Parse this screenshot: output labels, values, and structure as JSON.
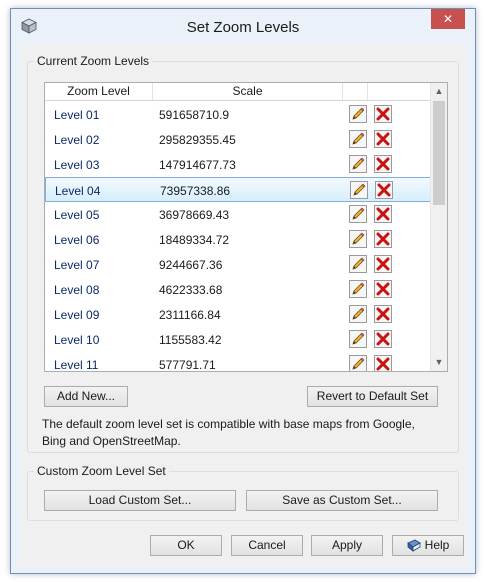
{
  "window": {
    "title": "Set Zoom Levels",
    "close_glyph": "✕"
  },
  "current_group": {
    "label": "Current Zoom Levels"
  },
  "grid": {
    "columns": [
      "Zoom Level",
      "Scale"
    ],
    "rows": [
      {
        "level": "Level 01",
        "scale": "591658710.9"
      },
      {
        "level": "Level 02",
        "scale": "295829355.45"
      },
      {
        "level": "Level 03",
        "scale": "147914677.73"
      },
      {
        "level": "Level 04",
        "scale": "73957338.86",
        "selected": true
      },
      {
        "level": "Level 05",
        "scale": "36978669.43"
      },
      {
        "level": "Level 06",
        "scale": "18489334.72"
      },
      {
        "level": "Level 07",
        "scale": "9244667.36"
      },
      {
        "level": "Level 08",
        "scale": "4622333.68"
      },
      {
        "level": "Level 09",
        "scale": "2311166.84"
      },
      {
        "level": "Level 10",
        "scale": "1155583.42"
      },
      {
        "level": "Level 11",
        "scale": "577791.71"
      }
    ],
    "row_actions": [
      "pencil-icon",
      "delete-x-icon"
    ]
  },
  "buttons": {
    "add_new": "Add New...",
    "revert": "Revert to Default Set",
    "load_custom": "Load Custom Set...",
    "save_custom": "Save as Custom Set...",
    "ok": "OK",
    "cancel": "Cancel",
    "apply": "Apply",
    "help": "Help"
  },
  "note": "The default zoom level set is compatible with base maps from Google, Bing and OpenStreetMap.",
  "custom_group": {
    "label": "Custom Zoom Level Set"
  },
  "colors": {
    "selected_row": "#d6effc",
    "delete_red": "#cc1111",
    "level_text": "#0b2a6b"
  }
}
